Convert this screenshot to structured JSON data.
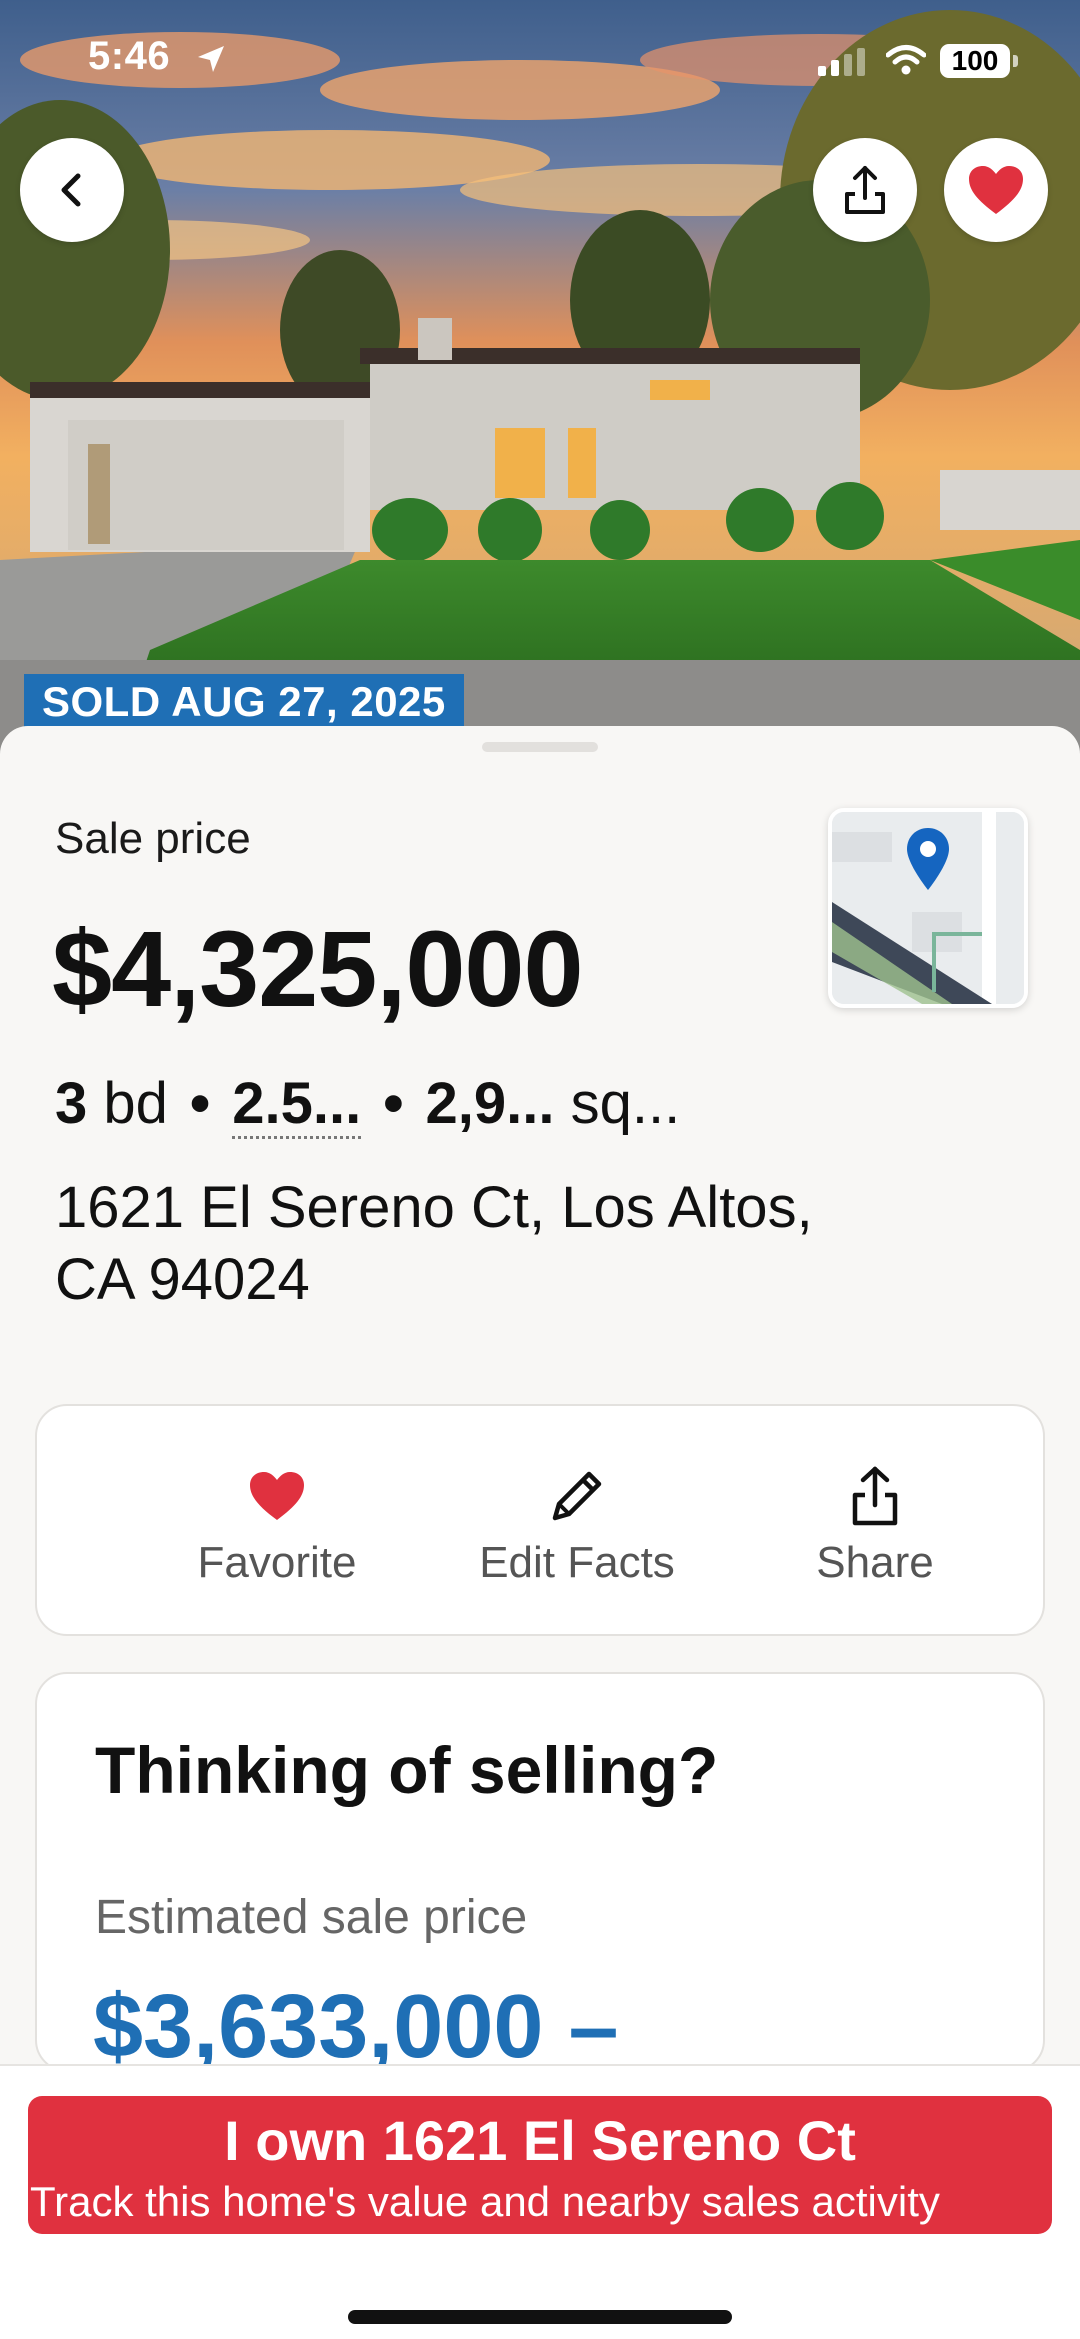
{
  "status_bar": {
    "time": "5:46",
    "battery": "100"
  },
  "hero": {
    "sold_badge": "SOLD AUG 27, 2025"
  },
  "listing": {
    "sale_label": "Sale price",
    "price": "$4,325,000",
    "beds_value": "3",
    "beds_unit": "bd",
    "baths_value": "2.5...",
    "sqft_value": "2,9...",
    "sqft_unit": "sq...",
    "address_line1": "1621 El Sereno Ct, Los Altos,",
    "address_line2": "CA 94024"
  },
  "actions": {
    "favorite": "Favorite",
    "edit_facts": "Edit Facts",
    "share": "Share"
  },
  "selling": {
    "title": "Thinking of selling?",
    "subtitle": "Estimated sale price",
    "range": "$3,633,000 –"
  },
  "cta": {
    "title": "I own 1621 El Sereno Ct",
    "subtitle": "Track this home's value and nearby sales activity"
  },
  "colors": {
    "accent_blue": "#1f6fb5",
    "cta_red": "#e0313f",
    "heart_red": "#e0313f"
  },
  "icons": [
    "back-icon",
    "share-icon",
    "heart-icon",
    "pencil-icon",
    "map-pin-icon",
    "location-arrow-icon",
    "wifi-icon",
    "signal-icon"
  ]
}
